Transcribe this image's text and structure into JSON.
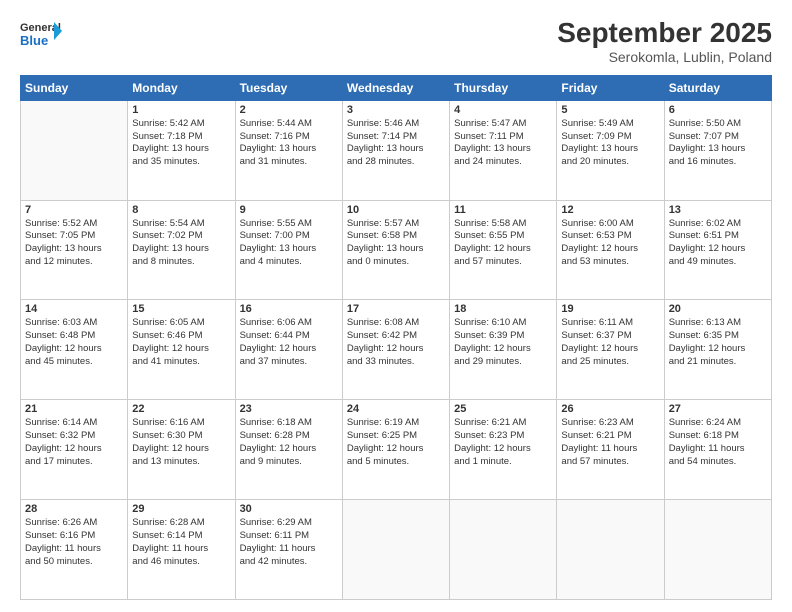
{
  "header": {
    "logo_line1": "General",
    "logo_line2": "Blue",
    "month_title": "September 2025",
    "location": "Serokomla, Lublin, Poland"
  },
  "days_of_week": [
    "Sunday",
    "Monday",
    "Tuesday",
    "Wednesday",
    "Thursday",
    "Friday",
    "Saturday"
  ],
  "weeks": [
    [
      {
        "day": "",
        "info": ""
      },
      {
        "day": "1",
        "info": "Sunrise: 5:42 AM\nSunset: 7:18 PM\nDaylight: 13 hours\nand 35 minutes."
      },
      {
        "day": "2",
        "info": "Sunrise: 5:44 AM\nSunset: 7:16 PM\nDaylight: 13 hours\nand 31 minutes."
      },
      {
        "day": "3",
        "info": "Sunrise: 5:46 AM\nSunset: 7:14 PM\nDaylight: 13 hours\nand 28 minutes."
      },
      {
        "day": "4",
        "info": "Sunrise: 5:47 AM\nSunset: 7:11 PM\nDaylight: 13 hours\nand 24 minutes."
      },
      {
        "day": "5",
        "info": "Sunrise: 5:49 AM\nSunset: 7:09 PM\nDaylight: 13 hours\nand 20 minutes."
      },
      {
        "day": "6",
        "info": "Sunrise: 5:50 AM\nSunset: 7:07 PM\nDaylight: 13 hours\nand 16 minutes."
      }
    ],
    [
      {
        "day": "7",
        "info": "Sunrise: 5:52 AM\nSunset: 7:05 PM\nDaylight: 13 hours\nand 12 minutes."
      },
      {
        "day": "8",
        "info": "Sunrise: 5:54 AM\nSunset: 7:02 PM\nDaylight: 13 hours\nand 8 minutes."
      },
      {
        "day": "9",
        "info": "Sunrise: 5:55 AM\nSunset: 7:00 PM\nDaylight: 13 hours\nand 4 minutes."
      },
      {
        "day": "10",
        "info": "Sunrise: 5:57 AM\nSunset: 6:58 PM\nDaylight: 13 hours\nand 0 minutes."
      },
      {
        "day": "11",
        "info": "Sunrise: 5:58 AM\nSunset: 6:55 PM\nDaylight: 12 hours\nand 57 minutes."
      },
      {
        "day": "12",
        "info": "Sunrise: 6:00 AM\nSunset: 6:53 PM\nDaylight: 12 hours\nand 53 minutes."
      },
      {
        "day": "13",
        "info": "Sunrise: 6:02 AM\nSunset: 6:51 PM\nDaylight: 12 hours\nand 49 minutes."
      }
    ],
    [
      {
        "day": "14",
        "info": "Sunrise: 6:03 AM\nSunset: 6:48 PM\nDaylight: 12 hours\nand 45 minutes."
      },
      {
        "day": "15",
        "info": "Sunrise: 6:05 AM\nSunset: 6:46 PM\nDaylight: 12 hours\nand 41 minutes."
      },
      {
        "day": "16",
        "info": "Sunrise: 6:06 AM\nSunset: 6:44 PM\nDaylight: 12 hours\nand 37 minutes."
      },
      {
        "day": "17",
        "info": "Sunrise: 6:08 AM\nSunset: 6:42 PM\nDaylight: 12 hours\nand 33 minutes."
      },
      {
        "day": "18",
        "info": "Sunrise: 6:10 AM\nSunset: 6:39 PM\nDaylight: 12 hours\nand 29 minutes."
      },
      {
        "day": "19",
        "info": "Sunrise: 6:11 AM\nSunset: 6:37 PM\nDaylight: 12 hours\nand 25 minutes."
      },
      {
        "day": "20",
        "info": "Sunrise: 6:13 AM\nSunset: 6:35 PM\nDaylight: 12 hours\nand 21 minutes."
      }
    ],
    [
      {
        "day": "21",
        "info": "Sunrise: 6:14 AM\nSunset: 6:32 PM\nDaylight: 12 hours\nand 17 minutes."
      },
      {
        "day": "22",
        "info": "Sunrise: 6:16 AM\nSunset: 6:30 PM\nDaylight: 12 hours\nand 13 minutes."
      },
      {
        "day": "23",
        "info": "Sunrise: 6:18 AM\nSunset: 6:28 PM\nDaylight: 12 hours\nand 9 minutes."
      },
      {
        "day": "24",
        "info": "Sunrise: 6:19 AM\nSunset: 6:25 PM\nDaylight: 12 hours\nand 5 minutes."
      },
      {
        "day": "25",
        "info": "Sunrise: 6:21 AM\nSunset: 6:23 PM\nDaylight: 12 hours\nand 1 minute."
      },
      {
        "day": "26",
        "info": "Sunrise: 6:23 AM\nSunset: 6:21 PM\nDaylight: 11 hours\nand 57 minutes."
      },
      {
        "day": "27",
        "info": "Sunrise: 6:24 AM\nSunset: 6:18 PM\nDaylight: 11 hours\nand 54 minutes."
      }
    ],
    [
      {
        "day": "28",
        "info": "Sunrise: 6:26 AM\nSunset: 6:16 PM\nDaylight: 11 hours\nand 50 minutes."
      },
      {
        "day": "29",
        "info": "Sunrise: 6:28 AM\nSunset: 6:14 PM\nDaylight: 11 hours\nand 46 minutes."
      },
      {
        "day": "30",
        "info": "Sunrise: 6:29 AM\nSunset: 6:11 PM\nDaylight: 11 hours\nand 42 minutes."
      },
      {
        "day": "",
        "info": ""
      },
      {
        "day": "",
        "info": ""
      },
      {
        "day": "",
        "info": ""
      },
      {
        "day": "",
        "info": ""
      }
    ]
  ]
}
